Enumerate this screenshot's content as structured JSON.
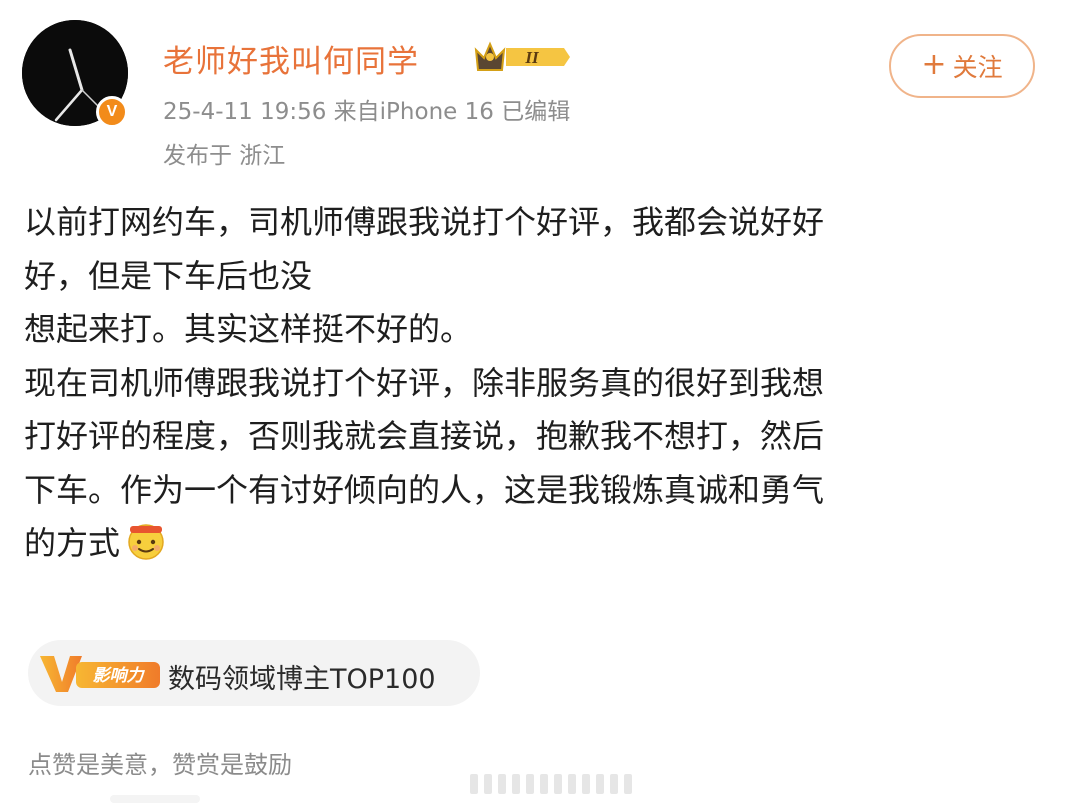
{
  "header": {
    "username": "老师好我叫何同学",
    "level_badge": "II",
    "meta_line": "25-4-11 19:56  来自iPhone 16  已编辑",
    "location_line": "发布于 浙江",
    "verified_badge": "V",
    "follow_label": "关注",
    "follow_plus": "+"
  },
  "post": {
    "lines": [
      "以前打网约车，司机师傅跟我说打个好评，我都会说好好",
      "好，但是下车后也没",
      "想起来打。其实这样挺不好的。",
      "现在司机师傅跟我说打个好评，除非服务真的很好到我想",
      "打好评的程度，否则我就会直接说，抱歉我不想打，然后",
      "下车。作为一个有讨好倾向的人，这是我锻炼真诚和勇气",
      "的方式"
    ]
  },
  "tag": {
    "badge_text": "影响力",
    "label": "数码领域博主TOP100"
  },
  "footer": {
    "text": "点赞是美意，赞赏是鼓励"
  },
  "colors": {
    "username": "#e8733a",
    "accent_orange": "#f28b1a",
    "meta_gray": "#8d8d8d"
  }
}
